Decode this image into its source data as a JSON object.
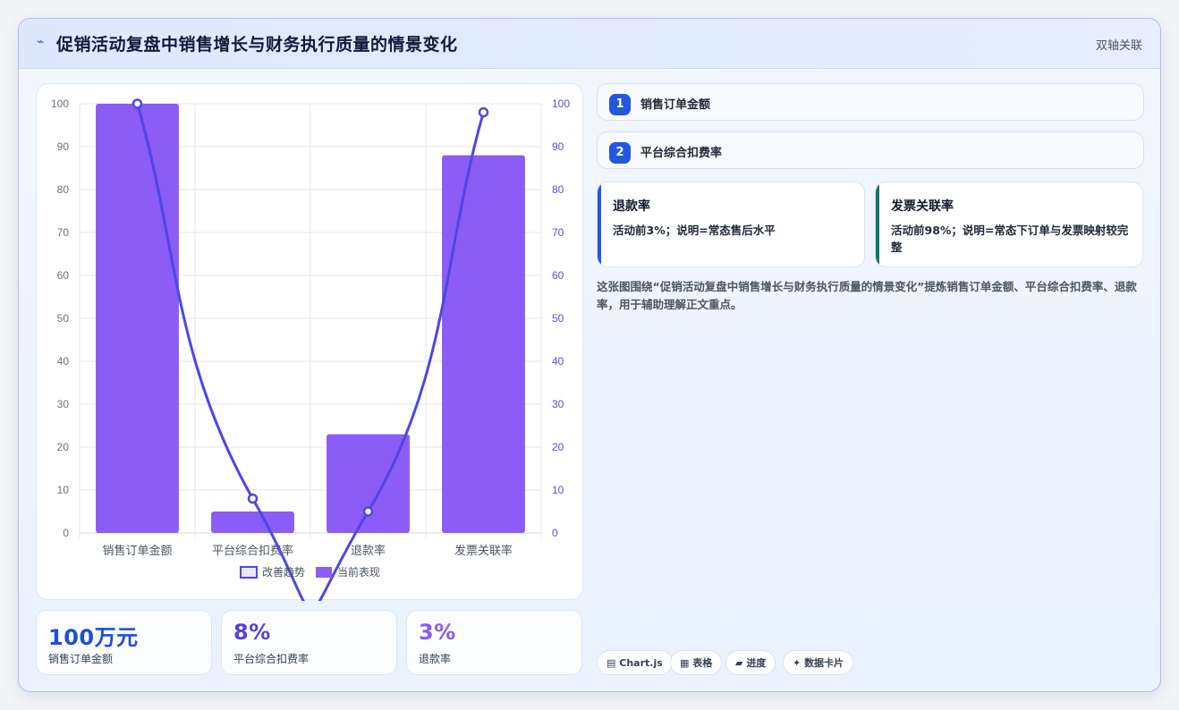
{
  "header": {
    "icon": "lightning-icon",
    "title": "促销活动复盘中销售增长与财务执行质量的情景变化",
    "badge": "双轴关联"
  },
  "chart_data": {
    "type": "bar",
    "categories": [
      "销售订单金额",
      "平台综合扣费率",
      "退款率",
      "发票关联率"
    ],
    "series": [
      {
        "name": "改善趋势",
        "type": "line",
        "axis": "right",
        "color": "#4f46e5",
        "values": [
          100,
          8,
          5,
          98
        ]
      },
      {
        "name": "当前表现",
        "type": "bar",
        "axis": "left",
        "color": "#8b5cf6",
        "values": [
          100,
          5,
          23,
          88
        ]
      }
    ],
    "y_left": {
      "min": 0,
      "max": 100,
      "ticks": [
        "0",
        "10",
        "20",
        "30",
        "40",
        "50",
        "60",
        "70",
        "80",
        "90",
        "100"
      ]
    },
    "y_right": {
      "min": 0,
      "max": 100,
      "ticks": [
        "0",
        "10",
        "20",
        "30",
        "40",
        "50",
        "60",
        "70",
        "80",
        "90",
        "100"
      ]
    },
    "grid": true,
    "legend_position": "bottom"
  },
  "stats": [
    {
      "value": "100万元",
      "label": "销售订单金额",
      "color": "#1d4ed8"
    },
    {
      "value": "8%",
      "label": "平台综合扣费率",
      "color": "#5b3fd6"
    },
    {
      "value": "3%",
      "label": "退款率",
      "color": "#8b5cf6"
    }
  ],
  "pills": [
    {
      "num": "1",
      "label": "销售订单金额"
    },
    {
      "num": "2",
      "label": "平台综合扣费率"
    }
  ],
  "notes": [
    {
      "title": "退款率",
      "desc": "活动前3%；说明=常态售后水平",
      "color": "#2357e0"
    },
    {
      "title": "发票关联率",
      "desc": "活动前98%；说明=常态下订单与发票映射较完整",
      "color": "#0f766e"
    }
  ],
  "summary": "这张图围绕“促销活动复盘中销售增长与财务执行质量的情景变化”提炼销售订单金额、平台综合扣费率、退款率，用于辅助理解正文重点。",
  "tags": [
    {
      "icon": "chart-icon",
      "glyph": "▤",
      "label": "Chart.js"
    },
    {
      "icon": "table-icon",
      "glyph": "▦",
      "label": "表格"
    },
    {
      "icon": "progress-icon",
      "glyph": "▰",
      "label": "进度"
    },
    {
      "icon": "sparkle-icon",
      "glyph": "✦",
      "label": "数据卡片"
    }
  ]
}
